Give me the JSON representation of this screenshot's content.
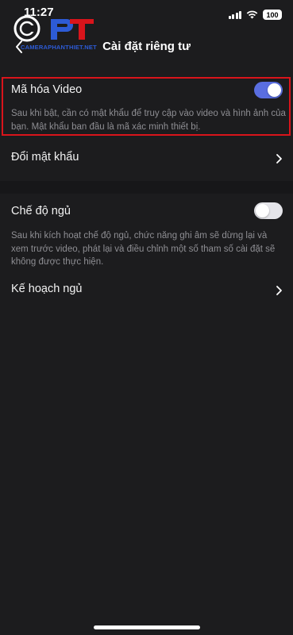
{
  "status_bar": {
    "time": "11:27",
    "battery": "100"
  },
  "watermark": {
    "text": "CAMERAPHANTHIET.NET"
  },
  "header": {
    "title": "Cài đặt riêng tư",
    "back_icon": "chevron-left-icon"
  },
  "settings": {
    "video_encryption": {
      "label": "Mã hóa Video",
      "enabled": true,
      "description": "Sau khi bật, cần có mật khẩu để truy cập vào video và hình ảnh của bạn. Mật khẩu ban đầu là mã xác minh thiết bị."
    },
    "change_password": {
      "label": "Đổi mật khẩu"
    },
    "sleep_mode": {
      "label": "Chế độ ngủ",
      "enabled": false,
      "description": "Sau khi kích hoạt chế độ ngủ, chức năng ghi âm sẽ dừng lại và xem trước video, phát lại và điều chỉnh một số tham số cài đặt sẽ không được thực hiện."
    },
    "sleep_schedule": {
      "label": "Kế hoạch ngủ"
    }
  },
  "colors": {
    "background": "#1c1c1e",
    "toggle_on": "#5a6ee0",
    "highlight_border": "#d9141b",
    "description_text": "#8e8e93"
  }
}
